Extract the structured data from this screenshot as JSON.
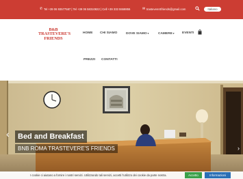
{
  "topbar": {
    "phones": "Tel +39 06 93577587 | Tel +39 06 58310822 | Cell +39 333 5558855",
    "email": "trastevereSfriends@gmail.com",
    "language": "Italiano",
    "background_color": "#cc3d33"
  },
  "logo": {
    "line1": "B&B",
    "line2": "TRASTEVERE'S",
    "line3": "FRIENDS"
  },
  "nav": {
    "home": "HOME",
    "chi_siamo": "CHI SIAMO",
    "dove_siamo": "DOVE SIAMO",
    "camere": "CAMERE",
    "eventi": "EVENTI",
    "prezzi": "PREZZI",
    "contatti": "CONTATTI"
  },
  "hero": {
    "title": "Bed and Breakfast",
    "subtitle": "BNB ROMA TRASTEVERE'S FRIENDS"
  },
  "cookie": {
    "text": "I cookie ci aiutano a fornire i nostri servizi. Utilizzando tali servizi, accetti l'utilizzo dei cookie da parte nostra.",
    "accept_label": "Accetto",
    "info_label": "Informazioni",
    "accept_color": "#3aa04a",
    "info_color": "#2a6fb5"
  }
}
